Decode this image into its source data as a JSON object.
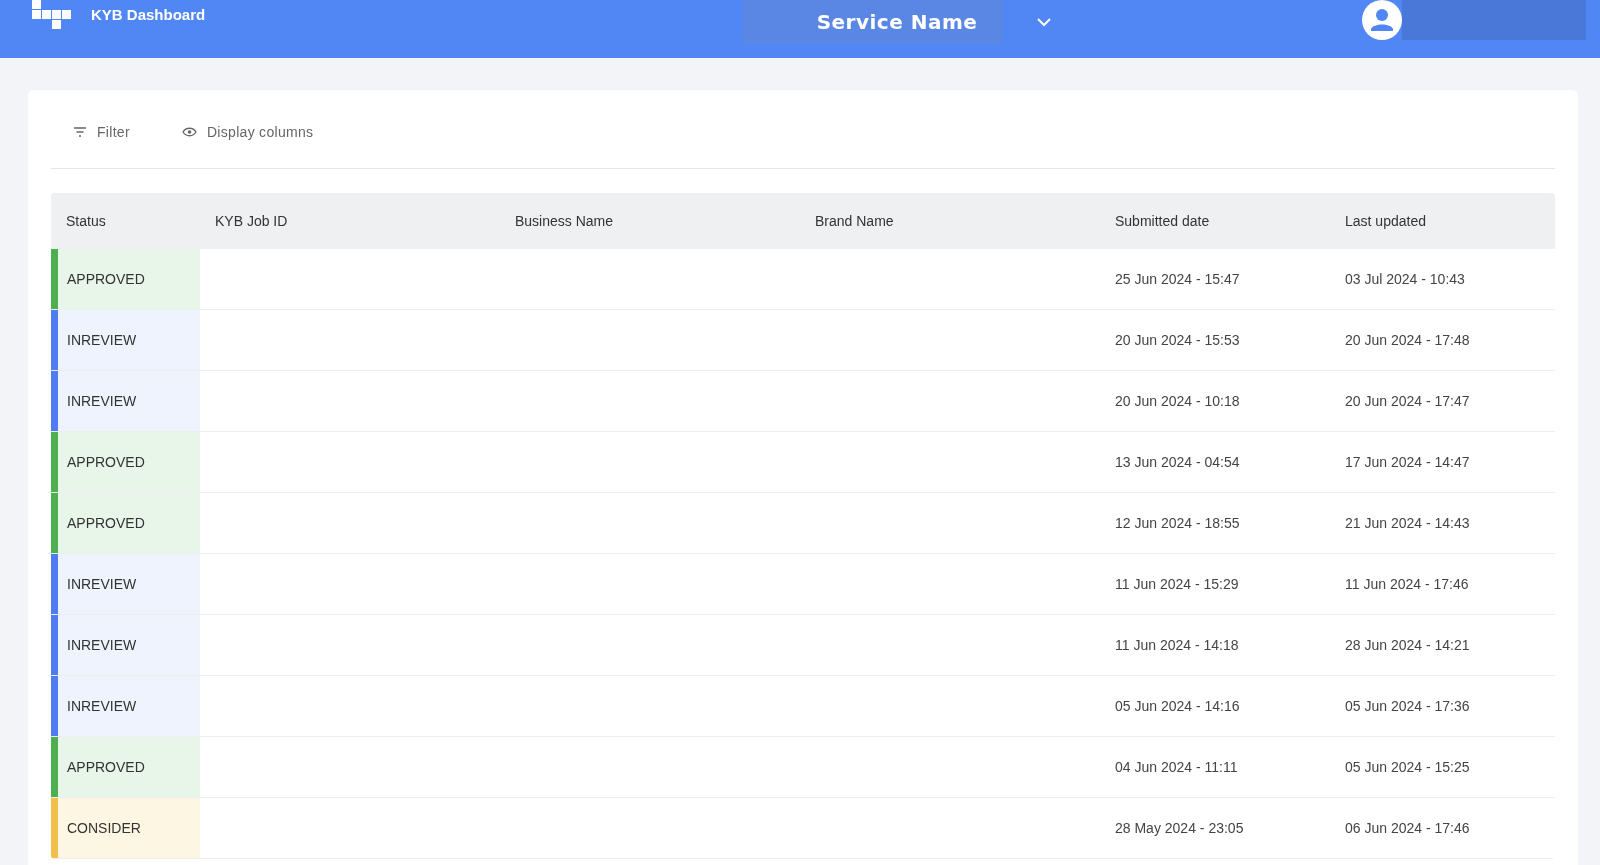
{
  "header": {
    "title": "KYB Dashboard",
    "service": "Service Name"
  },
  "toolbar": {
    "filter": "Filter",
    "display_columns": "Display columns"
  },
  "table": {
    "columns": [
      "Status",
      "KYB Job ID",
      "Business Name",
      "Brand Name",
      "Submitted date",
      "Last updated"
    ],
    "rows": [
      {
        "status": "APPROVED",
        "kind": "approved",
        "submitted": "25 Jun 2024 - 15:47",
        "updated": "03 Jul 2024 - 10:43"
      },
      {
        "status": "INREVIEW",
        "kind": "inreview",
        "submitted": "20 Jun 2024 - 15:53",
        "updated": "20 Jun 2024 - 17:48"
      },
      {
        "status": "INREVIEW",
        "kind": "inreview",
        "submitted": "20 Jun 2024 - 10:18",
        "updated": "20 Jun 2024 - 17:47"
      },
      {
        "status": "APPROVED",
        "kind": "approved",
        "submitted": "13 Jun 2024 - 04:54",
        "updated": "17 Jun 2024 - 14:47"
      },
      {
        "status": "APPROVED",
        "kind": "approved",
        "submitted": "12 Jun 2024 - 18:55",
        "updated": "21 Jun 2024 - 14:43"
      },
      {
        "status": "INREVIEW",
        "kind": "inreview",
        "submitted": "11 Jun 2024 - 15:29",
        "updated": "11 Jun 2024 - 17:46"
      },
      {
        "status": "INREVIEW",
        "kind": "inreview",
        "submitted": "11 Jun 2024 - 14:18",
        "updated": "28 Jun 2024 - 14:21"
      },
      {
        "status": "INREVIEW",
        "kind": "inreview",
        "submitted": "05 Jun 2024 - 14:16",
        "updated": "05 Jun 2024 - 17:36"
      },
      {
        "status": "APPROVED",
        "kind": "approved",
        "submitted": "04 Jun 2024 - 11:11",
        "updated": "05 Jun 2024 - 15:25"
      },
      {
        "status": "CONSIDER",
        "kind": "consider",
        "submitted": "28 May 2024 - 23:05",
        "updated": "06 Jun 2024 - 17:46"
      }
    ]
  }
}
